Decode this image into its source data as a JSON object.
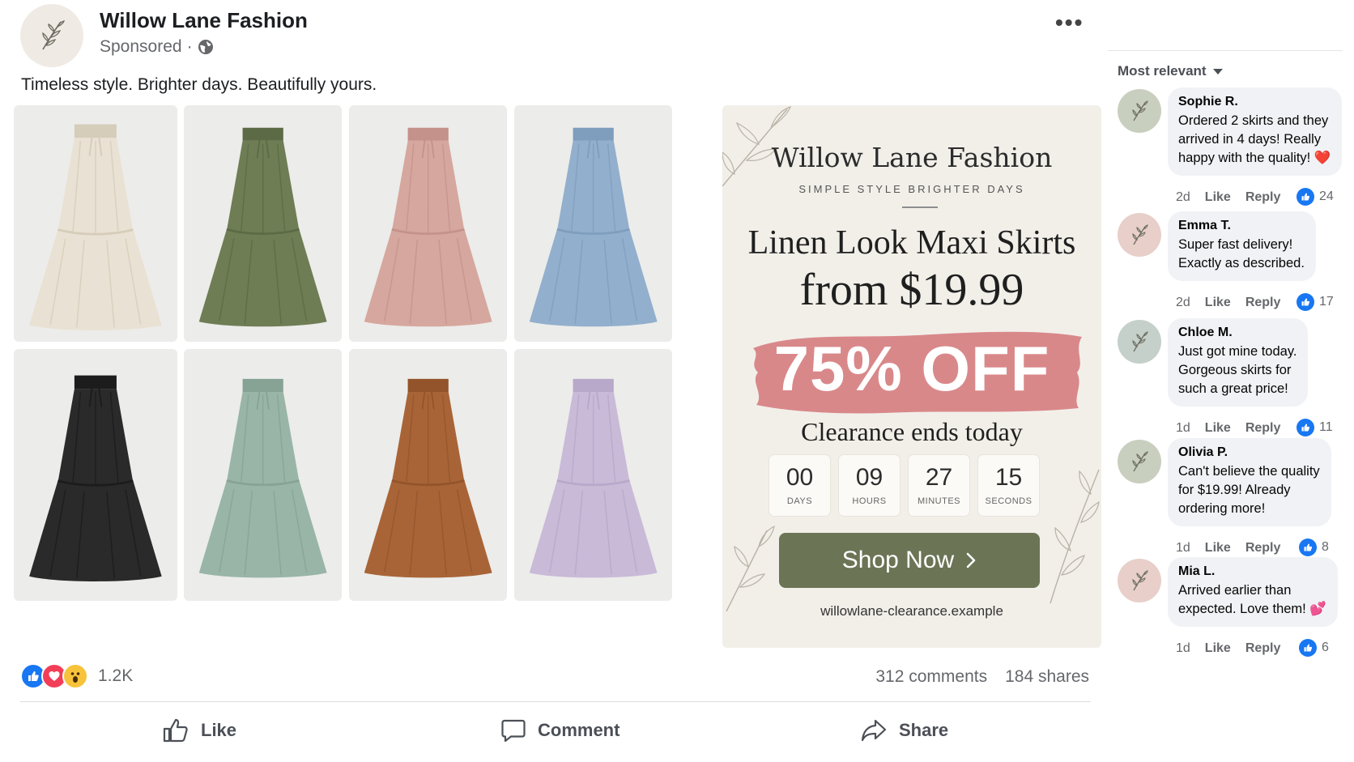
{
  "post": {
    "page_name": "Willow Lane Fashion",
    "sponsored": "Sponsored",
    "separator": "·",
    "caption": "Timeless style. Brighter days. Beautifully yours.",
    "more_icon": "more-horizontal-icon"
  },
  "skirts": [
    {
      "color": "#e9e1d3",
      "shade": "#d6ccba"
    },
    {
      "color": "#6e7d54",
      "shade": "#5c6a45"
    },
    {
      "color": "#d6a79e",
      "shade": "#c4928a"
    },
    {
      "color": "#92afcd",
      "shade": "#7f9dbd"
    },
    {
      "color": "#2a2a2a",
      "shade": "#1c1c1c"
    },
    {
      "color": "#98b5a8",
      "shade": "#86a396"
    },
    {
      "color": "#a86437",
      "shade": "#93542b"
    },
    {
      "color": "#c9bad8",
      "shade": "#b8a8c9"
    }
  ],
  "promo": {
    "brand": "Willow Lane Fashion",
    "tagline": "SIMPLE STYLE  BRIGHTER DAYS",
    "title": "Linen Look Maxi Skirts",
    "price": "from $19.99",
    "discount": "75% OFF",
    "subtitle": "Clearance ends today",
    "countdown": [
      {
        "value": "00",
        "label": "DAYS"
      },
      {
        "value": "09",
        "label": "HOURS"
      },
      {
        "value": "27",
        "label": "MINUTES"
      },
      {
        "value": "15",
        "label": "SECONDS"
      }
    ],
    "cta": "Shop Now",
    "url": "willowlane-clearance.example",
    "brush_color": "#d9888a",
    "cta_color": "#6b7455"
  },
  "engagement": {
    "reaction_icons": [
      "like-reaction-icon",
      "love-reaction-icon",
      "wow-reaction-icon"
    ],
    "reaction_count": "1.2K",
    "comments": "312 comments",
    "shares": "184 shares"
  },
  "actions": {
    "like": "Like",
    "comment": "Comment",
    "share": "Share"
  },
  "comments_panel": {
    "sort_label": "Most relevant",
    "items": [
      {
        "name": "Sophie R.",
        "lines": [
          "Ordered 2 skirts and they",
          "arrived in 4 days! Really",
          "happy with the quality! ❤️"
        ],
        "time": "2d",
        "like": "Like",
        "reply": "Reply",
        "likes": "24",
        "avatar_bg": "#c9cfbf"
      },
      {
        "name": "Emma T.",
        "lines": [
          "Super fast delivery!",
          "Exactly as described."
        ],
        "time": "2d",
        "like": "Like",
        "reply": "Reply",
        "likes": "17",
        "avatar_bg": "#e8cfc9"
      },
      {
        "name": "Chloe M.",
        "lines": [
          "Just got mine today.",
          "Gorgeous skirts for",
          "such a great price!"
        ],
        "time": "1d",
        "like": "Like",
        "reply": "Reply",
        "likes": "11",
        "avatar_bg": "#c4d0c9"
      },
      {
        "name": "Olivia P.",
        "lines": [
          "Can't believe the quality",
          "for $19.99! Already",
          "ordering more!"
        ],
        "time": "1d",
        "like": "Like",
        "reply": "Reply",
        "likes": "8",
        "avatar_bg": "#c9cfbf"
      },
      {
        "name": "Mia L.",
        "lines": [
          "Arrived earlier than",
          "expected. Love them! 💕"
        ],
        "time": "1d",
        "like": "Like",
        "reply": "Reply",
        "likes": "6",
        "avatar_bg": "#e8cfc9"
      }
    ]
  }
}
